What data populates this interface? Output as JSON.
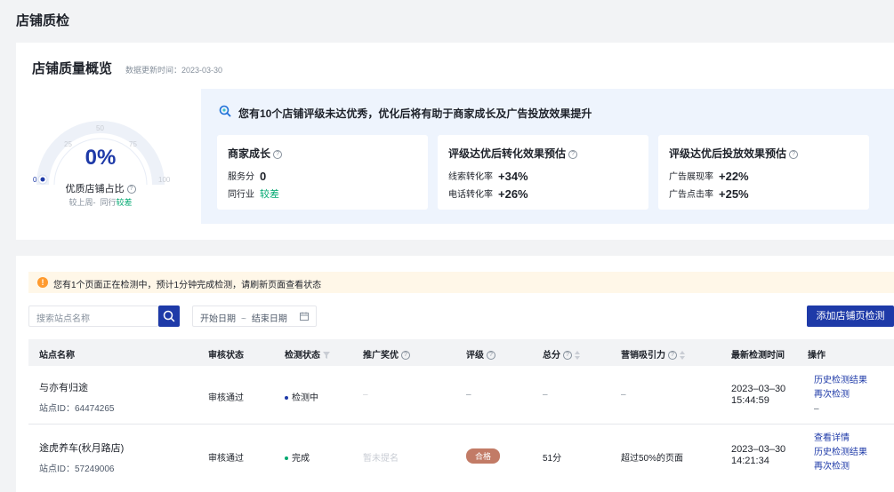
{
  "page_title": "店铺质检",
  "overview": {
    "title": "店铺质量概览",
    "update_time": "数据更新时间：2023-03-30",
    "gauge": {
      "value_text": "0%",
      "value_fraction": 0,
      "label": "优质店铺占比",
      "ticks": [
        "0",
        "25",
        "50",
        "75",
        "100"
      ],
      "compare_text": "较上周-",
      "peer_label": "同行",
      "peer_value": "较差"
    },
    "tip": "您有10个店铺评级未达优秀，优化后将有助于商家成长及广告投放效果提升",
    "cards": [
      {
        "title": "商家成长",
        "rows": [
          {
            "label": "服务分",
            "value": "0"
          },
          {
            "label": "同行业",
            "value": "较差"
          }
        ]
      },
      {
        "title": "评级达优后转化效果预估",
        "rows": [
          {
            "label": "线索转化率",
            "value": "+34%"
          },
          {
            "label": "电话转化率",
            "value": "+26%"
          }
        ]
      },
      {
        "title": "评级达优后投放效果预估",
        "rows": [
          {
            "label": "广告展现率",
            "value": "+22%"
          },
          {
            "label": "广告点击率",
            "value": "+25%"
          }
        ]
      }
    ]
  },
  "notice": "您有1个页面正在检测中，预计1分钟完成检测，请刷新页面查看状态",
  "toolbar": {
    "search_placeholder": "搜索站点名称",
    "date_start": "开始日期",
    "date_sep": "~",
    "date_end": "结束日期",
    "add_label": "添加店铺页检测"
  },
  "table": {
    "columns": [
      "站点名称",
      "审核状态",
      "检测状态",
      "推广奖优",
      "评级",
      "总分",
      "营销吸引力",
      "最新检测时间",
      "操作"
    ],
    "rows": [
      {
        "name": "与亦有归途",
        "id": "站点ID：64474265",
        "audit": "审核通过",
        "detect": "检测中",
        "promo": "–",
        "grade": "–",
        "score": "–",
        "appeal": "–",
        "date": "2023–03–30",
        "time": "15:44:59",
        "actions": [
          "历史检测结果",
          "再次检测"
        ],
        "extra": "–"
      },
      {
        "name": "途虎养车(秋月路店)",
        "id": "站点ID：57249006",
        "audit": "审核通过",
        "detect": "完成",
        "promo": "暂未提名",
        "grade": "合格",
        "score": "51分",
        "appeal": "超过50%的页面",
        "date": "2023–03–30",
        "time": "14:21:34",
        "actions": [
          "查看详情",
          "历史检测结果",
          "再次检测"
        ]
      }
    ]
  },
  "colors": {
    "primary": "#1e3aa8",
    "success": "#00a870",
    "warning": "#ff9a2e",
    "grade_pill": "#c27b66"
  }
}
